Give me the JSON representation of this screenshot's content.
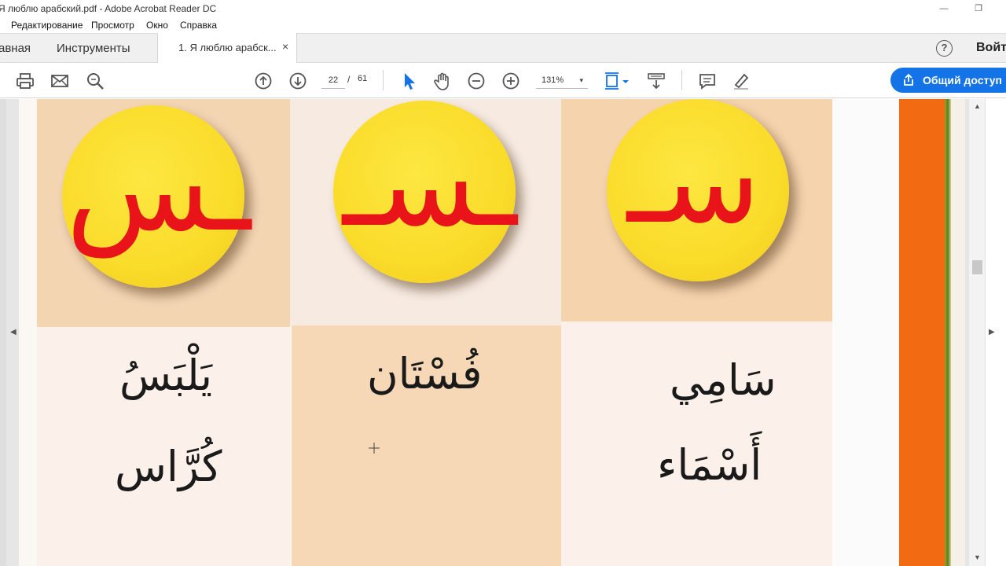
{
  "window": {
    "title": "Я люблю арабский.pdf - Adobe Acrobat Reader DC",
    "restore_glyph": "❐",
    "minimize_glyph": "—"
  },
  "menu": {
    "items": [
      "Редактирование",
      "Просмотр",
      "Окно",
      "Справка"
    ]
  },
  "tabs": {
    "home": "авная",
    "tools": "Инструменты",
    "document": "1. Я люблю арабск...",
    "close_glyph": "×",
    "help_glyph": "?",
    "signin": "Войт"
  },
  "toolbar": {
    "icons": [
      "print-icon",
      "email-icon",
      "search-icon",
      "page-up-icon",
      "page-down-icon",
      "select-cursor-icon",
      "hand-tool-icon",
      "zoom-out-icon",
      "zoom-in-icon",
      "page-fit-icon",
      "scroll-mode-icon",
      "comment-icon",
      "highlight-pen-icon"
    ],
    "page_current": "22",
    "page_separator": "/",
    "page_total": "61",
    "zoom": "131%",
    "zoom_caret": "▾",
    "share_label": "Общий доступ",
    "accent_color": "#1473e6"
  },
  "page": {
    "letters": [
      {
        "glyph": "ـس",
        "color": "#e8141a"
      },
      {
        "glyph": "ـسـ",
        "color": "#e8141a"
      },
      {
        "glyph": "سـ",
        "color": "#e8141a"
      }
    ],
    "words": {
      "col1_top": "يَلْبَسُ",
      "col1_bottom": "كُرَّاس",
      "col2_top": "فُسْتَان",
      "col3_top": "سَامِي",
      "col3_bottom": "أَسْمَاء"
    },
    "colors": {
      "circle_yellow": "#fadc2a",
      "tile_tan": "#f3d7b4",
      "tile_light": "#fbf0e8",
      "orange_strip": "#f26a12"
    }
  },
  "scroll": {
    "up_glyph": "▲",
    "down_glyph": "▼",
    "left_glyph": "◀",
    "right_glyph": "▶"
  }
}
